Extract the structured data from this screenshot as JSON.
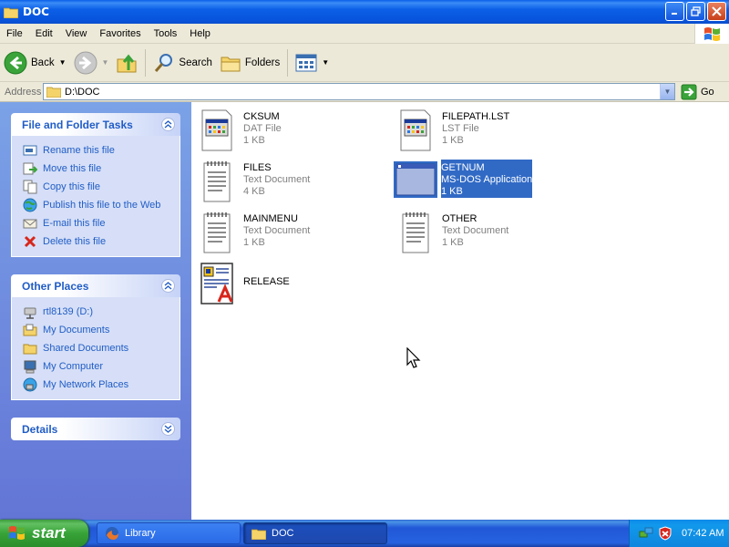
{
  "window": {
    "title": "DOC"
  },
  "menu": [
    "File",
    "Edit",
    "View",
    "Favorites",
    "Tools",
    "Help"
  ],
  "toolbar": {
    "back": "Back",
    "search": "Search",
    "folders": "Folders"
  },
  "address": {
    "label": "Address",
    "value": "D:\\DOC",
    "go": "Go"
  },
  "tasks": {
    "title": "File and Folder Tasks",
    "items": [
      "Rename this file",
      "Move this file",
      "Copy this file",
      "Publish this file to the Web",
      "E-mail this file",
      "Delete this file"
    ]
  },
  "other_places": {
    "title": "Other Places",
    "items": [
      "rtl8139 (D:)",
      "My Documents",
      "Shared Documents",
      "My Computer",
      "My Network Places"
    ]
  },
  "details": {
    "title": "Details"
  },
  "files": [
    {
      "name": "CKSUM",
      "type": "DAT File",
      "size": "1 KB",
      "icon": "dat-file-icon"
    },
    {
      "name": "FILEPATH.LST",
      "type": "LST File",
      "size": "1 KB",
      "icon": "lst-file-icon"
    },
    {
      "name": "FILES",
      "type": "Text Document",
      "size": "4 KB",
      "icon": "text-document-icon"
    },
    {
      "name": "GETNUM",
      "type": "MS-DOS Application",
      "size": "1 KB",
      "icon": "dos-app-icon",
      "selected": true
    },
    {
      "name": "MAINMENU",
      "type": "Text Document",
      "size": "1 KB",
      "icon": "text-document-icon"
    },
    {
      "name": "OTHER",
      "type": "Text Document",
      "size": "1 KB",
      "icon": "text-document-icon"
    },
    {
      "name": "RELEASE",
      "type": "",
      "size": "",
      "icon": "wordpad-document-icon"
    }
  ],
  "taskbar": {
    "start": "start",
    "tasks": [
      {
        "label": "Library",
        "icon": "firefox-icon",
        "active": false
      },
      {
        "label": "DOC",
        "icon": "folder-icon",
        "active": true
      }
    ],
    "clock": "07:42 AM"
  },
  "colors": {
    "title_blue": "#0a5fe8",
    "pane_blue": "#7ba2e7",
    "link_blue": "#215dc6",
    "selection": "#316ac5",
    "start_green": "#37a337"
  }
}
